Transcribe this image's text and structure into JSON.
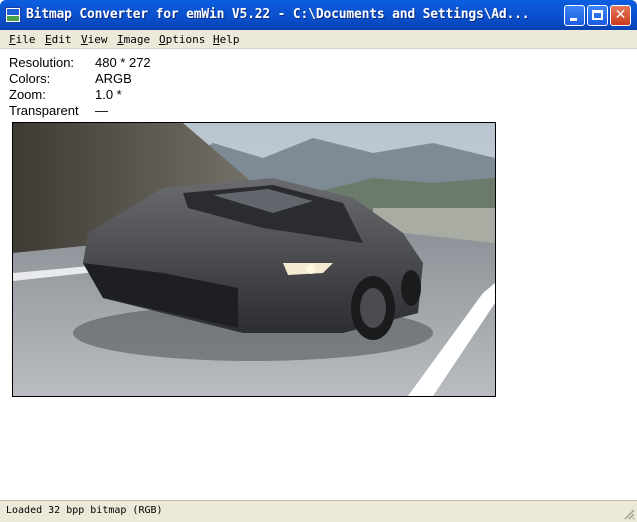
{
  "window": {
    "title": "Bitmap Converter for emWin V5.22 - C:\\Documents and Settings\\Ad..."
  },
  "menu": {
    "items": [
      {
        "first": "F",
        "rest": "ile"
      },
      {
        "first": "E",
        "rest": "dit"
      },
      {
        "first": "V",
        "rest": "iew"
      },
      {
        "first": "I",
        "rest": "mage"
      },
      {
        "first": "O",
        "rest": "ptions"
      },
      {
        "first": "H",
        "rest": "elp"
      }
    ]
  },
  "info": {
    "resolution_label": "Resolution:",
    "resolution_value": "480 * 272",
    "colors_label": "Colors:",
    "colors_value": "ARGB",
    "zoom_label": "Zoom:",
    "zoom_value": "1.0 *",
    "transparent_label": "Transparent",
    "transparent_value": "—"
  },
  "image": {
    "subject": "dark grey sports car on a mountain road"
  },
  "status": {
    "text": "Loaded 32 bpp bitmap (RGB)"
  },
  "colors": {
    "titlebar": "#0a5fe0",
    "menubar": "#ece9d8",
    "close_button": "#c83c1c"
  }
}
